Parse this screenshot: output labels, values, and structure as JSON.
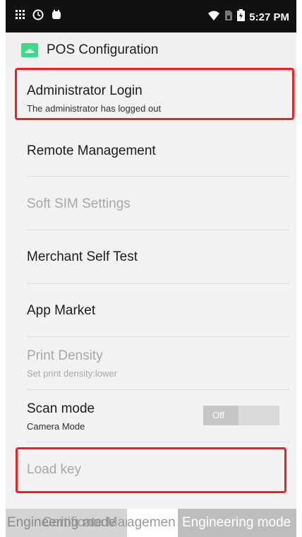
{
  "status_bar": {
    "time": "5:27 PM",
    "left_icons": [
      "notification-grid-icon",
      "clock-icon",
      "app-notification-icon"
    ],
    "right_icons": [
      "wifi-icon",
      "sim-icon",
      "battery-icon"
    ]
  },
  "app_bar": {
    "title": "POS Configuration",
    "icon": "android-app-icon"
  },
  "settings": {
    "admin_login": {
      "title": "Administrator Login",
      "summary": "The administrator has logged out"
    },
    "remote_management": {
      "title": "Remote Management"
    },
    "soft_sim": {
      "title": "Soft SIM Settings"
    },
    "merchant_self_test": {
      "title": "Merchant Self Test"
    },
    "app_market": {
      "title": "App Market"
    },
    "print_density": {
      "title": "Print Density",
      "summary": "Set print density:lower"
    },
    "scan_mode": {
      "title": "Scan mode",
      "summary": "Camera Mode",
      "toggle_label": "Off"
    },
    "load_key": {
      "title": "Load key"
    }
  },
  "bottom_bar": {
    "tab_left": "Engineering mode",
    "tab_left_overlap": "Certificate Manage",
    "tab_middle": "agemen",
    "tab_right": "Engineering mode"
  },
  "colors": {
    "highlight": "#f21f1f",
    "android_green": "#3ddc84",
    "status_bar": "#111111"
  }
}
